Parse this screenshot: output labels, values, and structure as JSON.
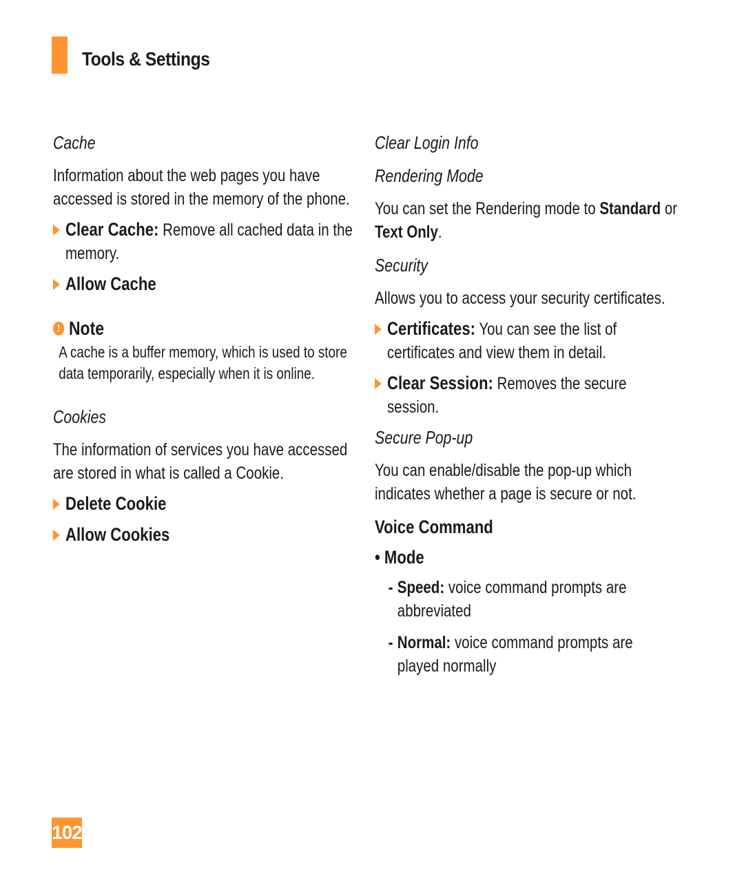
{
  "header": {
    "title": "Tools & Settings",
    "accent_color": "#ff9433"
  },
  "left": {
    "cache": {
      "title": "Cache",
      "description": "Information about the web pages you have accessed is stored in the memory of the phone.",
      "items": [
        {
          "label": "Clear Cache:",
          "text": " Remove all cached data in the memory."
        },
        {
          "label": "Allow Cache",
          "text": ""
        }
      ]
    },
    "note": {
      "icon": "exclamation-circle-icon",
      "title": "Note",
      "text": "A cache is a buffer memory, which is used to store data temporarily, especially when it is online."
    },
    "cookies": {
      "title": "Cookies",
      "description": "The information of services you have accessed are stored in what is called a Cookie.",
      "items": [
        {
          "label": "Delete Cookie"
        },
        {
          "label": "Allow Cookies"
        }
      ]
    }
  },
  "right": {
    "clear_login": {
      "title": "Clear Login Info"
    },
    "rendering": {
      "title": "Rendering Mode",
      "text_pre": "You can set the Rendering mode to ",
      "opt1": "Standard",
      "text_mid": " or ",
      "opt2": "Text Only",
      "text_post": "."
    },
    "security": {
      "title": "Security",
      "description": "Allows you to access your security certificates.",
      "items": [
        {
          "label": "Certificates:",
          "text": " You can see the list of certificates and view them in detail."
        },
        {
          "label": "Clear Session:",
          "text": " Removes the secure session."
        }
      ]
    },
    "secure_popup": {
      "title": "Secure Pop-up",
      "description": "You can enable/disable the pop-up which indicates whether a page is secure or not."
    },
    "voice": {
      "title": "Voice Command",
      "mode_label": "• Mode",
      "items": [
        {
          "dash": "-",
          "label": "Speed:",
          "text": " voice command prompts are abbreviated"
        },
        {
          "dash": "-",
          "label": "Normal:",
          "text": " voice command prompts are played normally"
        }
      ]
    }
  },
  "footer": {
    "page_number": "102"
  }
}
